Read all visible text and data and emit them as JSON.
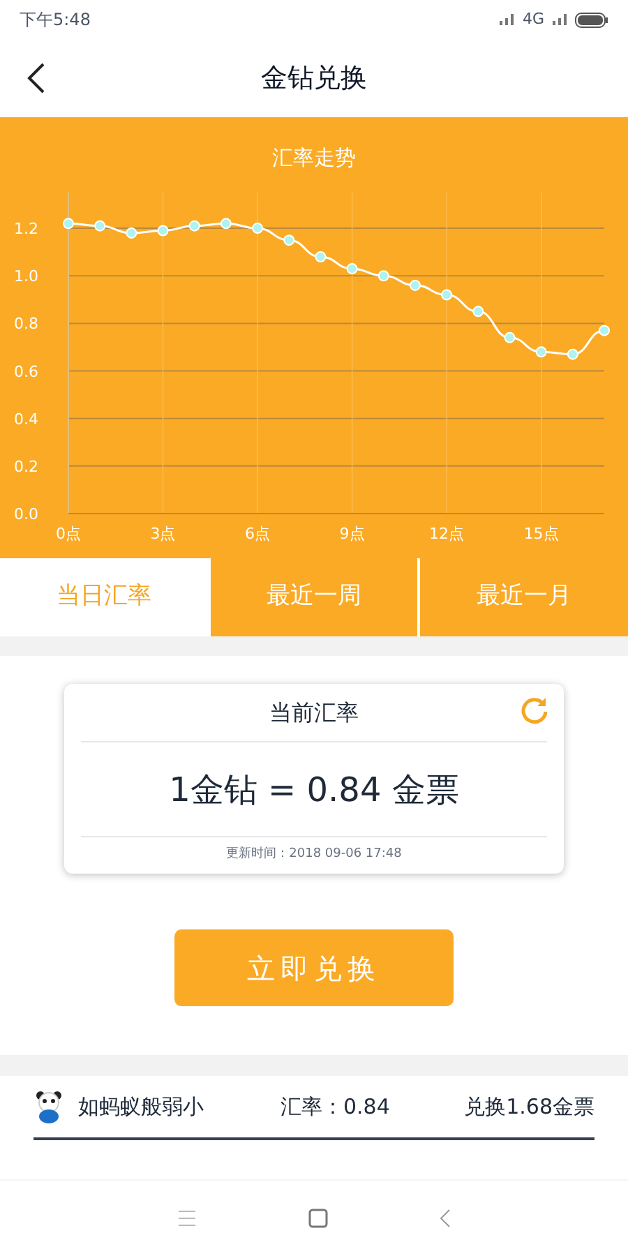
{
  "status_bar": {
    "time": "下午5:48",
    "network": "4G"
  },
  "header": {
    "title": "金钻兑换"
  },
  "chart": {
    "chart_data": {
      "type": "line",
      "title": "汇率走势",
      "x": [
        0,
        1,
        2,
        3,
        4,
        5,
        6,
        7,
        8,
        9,
        10,
        11,
        12,
        13,
        14,
        15,
        16,
        17
      ],
      "grid": true,
      "series": [
        {
          "color": "#ffffff",
          "marker": true,
          "values": [
            1.22,
            1.21,
            1.18,
            1.19,
            1.21,
            1.22,
            1.2,
            1.15,
            1.08,
            1.03,
            1.0,
            0.96,
            0.92,
            0.85,
            0.74,
            0.68,
            0.67,
            0.77
          ]
        }
      ],
      "xlim": [
        0,
        17
      ],
      "ylim": [
        0,
        1.35
      ],
      "xticks": [
        {
          "value": 0,
          "label": "0点"
        },
        {
          "value": 3,
          "label": "3点"
        },
        {
          "value": 6,
          "label": "6点"
        },
        {
          "value": 9,
          "label": "9点"
        },
        {
          "value": 12,
          "label": "12点"
        },
        {
          "value": 15,
          "label": "15点"
        }
      ],
      "yticks": [
        {
          "value": 0,
          "label": "0.0"
        },
        {
          "value": 0.2,
          "label": "0.2"
        },
        {
          "value": 0.4,
          "label": "0.4"
        },
        {
          "value": 0.6,
          "label": "0.6"
        },
        {
          "value": 0.8,
          "label": "0.8"
        },
        {
          "value": 1.0,
          "label": "1.0"
        },
        {
          "value": 1.2,
          "label": "1.2"
        }
      ]
    }
  },
  "tabs": [
    {
      "label": "当日汇率",
      "selected": true
    },
    {
      "label": "最近一周",
      "selected": false
    },
    {
      "label": "最近一月",
      "selected": false
    }
  ],
  "rate_card": {
    "title": "当前汇率",
    "rate": "1金钻 = 0.84 金票",
    "updated": "更新时间：2018 09-06 17:48"
  },
  "exchange_button": "立即兑换",
  "records": [
    {
      "user": "如蚂蚁般弱小",
      "rate": "汇率：0.84",
      "amount": "兑换1.68金票"
    }
  ]
}
